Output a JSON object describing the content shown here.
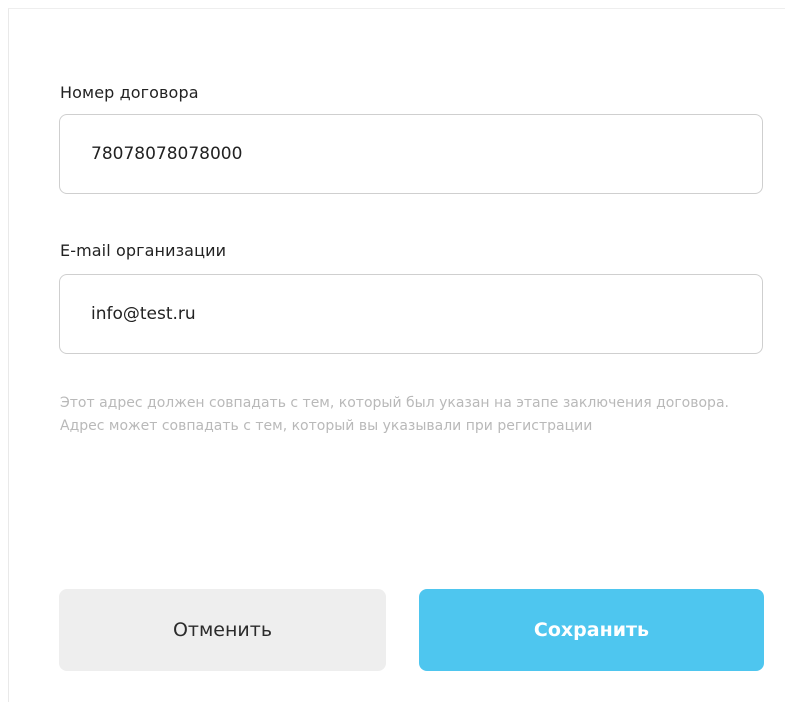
{
  "form": {
    "contract_number": {
      "label": "Номер договора",
      "value": "78078078078000"
    },
    "org_email": {
      "label": "E-mail организации",
      "value": "info@test.ru"
    },
    "hint_text": "Этот адрес должен совпадать с тем, который был указан на этапе заключения договора. Адрес может совпадать с тем, который вы указывали при регистрации"
  },
  "actions": {
    "cancel_label": "Отменить",
    "save_label": "Сохранить"
  },
  "colors": {
    "accent": "#4ec6ef",
    "cancel_bg": "#eeeeee",
    "hint": "#b9b9b9",
    "input_border": "#cfcfcf"
  }
}
